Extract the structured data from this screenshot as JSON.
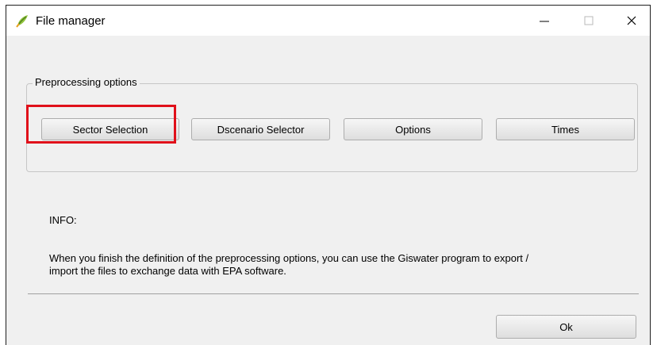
{
  "window": {
    "title": "File manager",
    "icon": "qgis-leaf-icon",
    "controls": {
      "minimize": "—",
      "maximize": "☐",
      "close": "✕"
    }
  },
  "preprocessing": {
    "legend": "Preprocessing options",
    "buttons": {
      "sector_selection": "Sector Selection",
      "dscenario_selector": "Dscenario Selector",
      "options": "Options",
      "times": "Times"
    },
    "highlighted": "sector_selection",
    "highlight_color": "#e0101a"
  },
  "info": {
    "label": "INFO:",
    "line1": "When you finish the definition of the preprocessing options, you can use the Giswater program to export /",
    "line2": "import the files to exchange data with EPA software."
  },
  "footer": {
    "ok_label": "Ok"
  }
}
